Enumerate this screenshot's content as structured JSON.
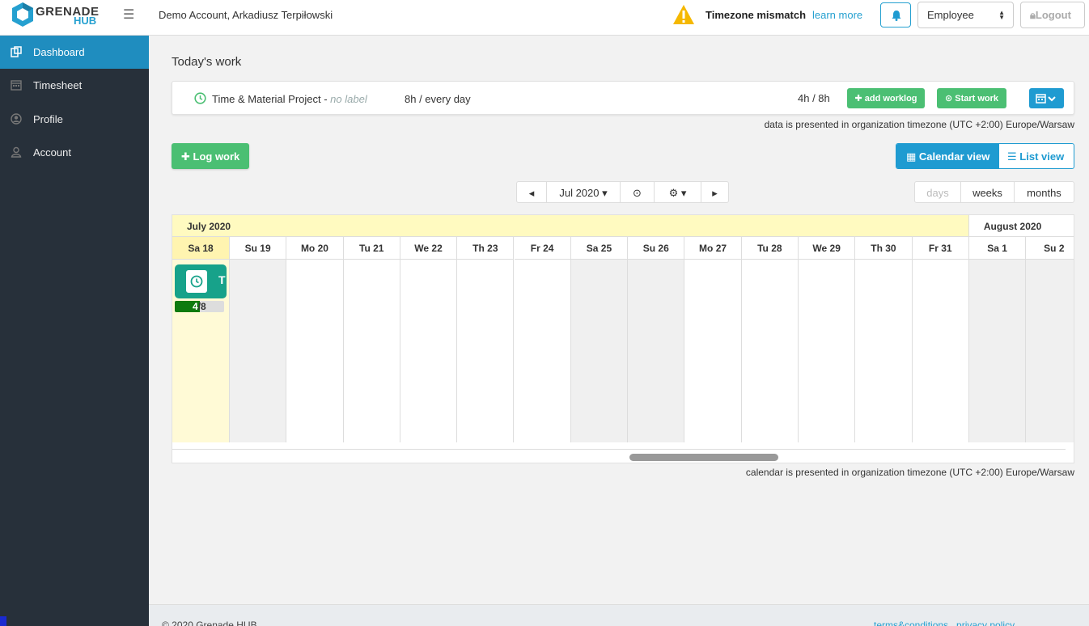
{
  "header": {
    "logo_top": "GRENADE",
    "logo_bottom": "HUB",
    "account_name": "Demo Account, Arkadiusz Terpiłowski",
    "timezone_warning": "Timezone mismatch",
    "learn_more": "learn more",
    "role_select_value": "Employee",
    "logout_label": "Logout"
  },
  "sidebar": {
    "items": [
      {
        "label": "Dashboard",
        "icon": "dashboard-icon",
        "active": true
      },
      {
        "label": "Timesheet",
        "icon": "calendar-icon"
      },
      {
        "label": "Profile",
        "icon": "user-circle-icon"
      },
      {
        "label": "Account",
        "icon": "user-icon"
      }
    ]
  },
  "main": {
    "title": "Today's work",
    "work": {
      "project": "Time & Material Project",
      "separator": " - ",
      "label": "no label",
      "schedule": "8h / every day",
      "hours": "4h / 8h",
      "add_worklog": "add worklog",
      "start_work": "Start work"
    },
    "tz_note_data": "data is presented in organization timezone (UTC +2:00) Europe/Warsaw",
    "log_work": "Log work",
    "calendar_view": "Calendar view",
    "list_view": "List view",
    "nav": {
      "current": "Jul 2020"
    },
    "ranges": {
      "days": "days",
      "weeks": "weeks",
      "months": "months"
    },
    "tz_note_calendar": "calendar is presented in organization timezone (UTC +2:00) Europe/Warsaw"
  },
  "calendar": {
    "months": [
      "July 2020",
      "August 2020"
    ],
    "days": [
      "Sa 18",
      "Su 19",
      "Mo 20",
      "Tu 21",
      "We 22",
      "Th 23",
      "Fr 24",
      "Sa 25",
      "Su 26",
      "Mo 27",
      "Tu 28",
      "We 29",
      "Th 30",
      "Fr 31",
      "Sa 1",
      "Su 2"
    ],
    "weekend_indexes": [
      1,
      7,
      8,
      14,
      15
    ],
    "today_index": 0,
    "event": {
      "text": "T",
      "logged": "4",
      "planned": "/8",
      "progress": 0.5
    }
  },
  "footer": {
    "copyright": "© 2020 Grenade HUB",
    "links": "terms&conditions   privacy policy"
  },
  "colors": {
    "accent": "#1f9bd1",
    "success": "#4bbf73",
    "sidebar": "#27303a",
    "event": "#17a28a"
  }
}
